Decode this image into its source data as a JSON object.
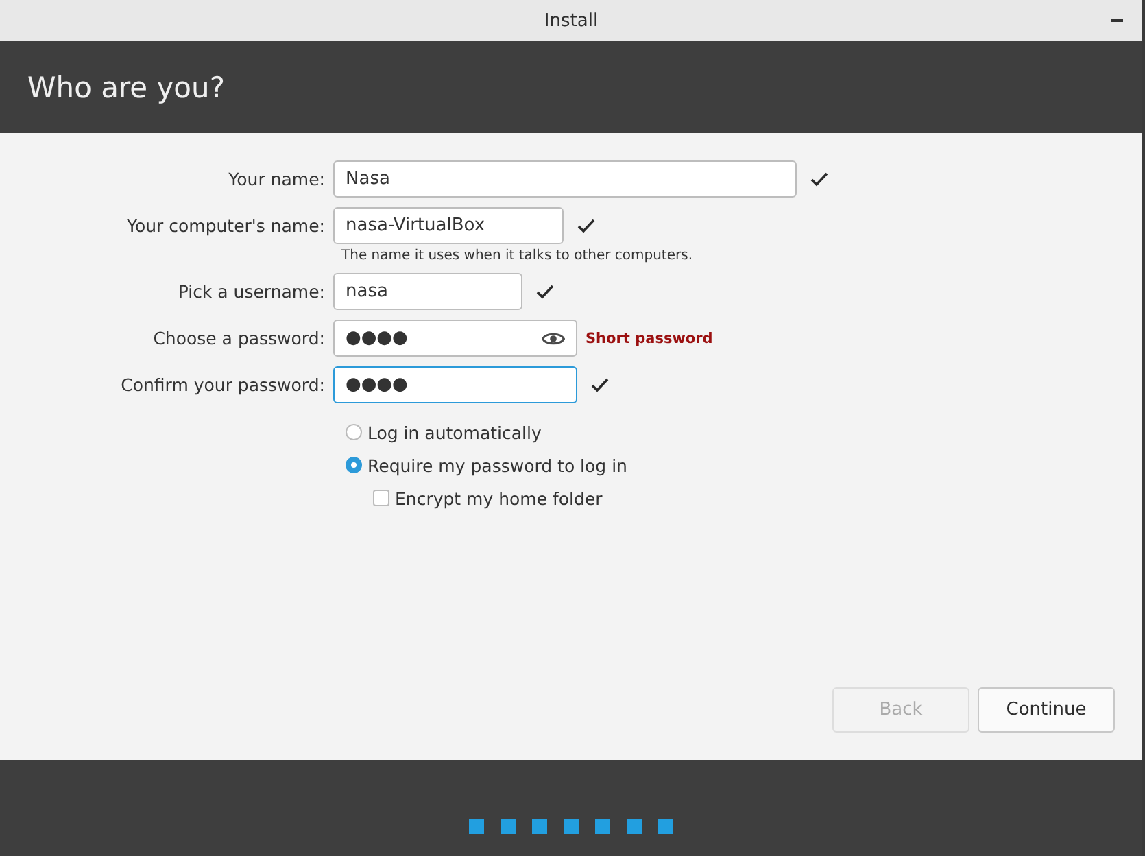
{
  "window": {
    "title": "Install"
  },
  "header": {
    "title": "Who are you?"
  },
  "fields": [
    {
      "label": "Your name:",
      "value": "Nasa",
      "kind": "text",
      "valid": true,
      "focused": false
    },
    {
      "label": "Your computer's name:",
      "value": "nasa-VirtualBox",
      "kind": "text",
      "valid": true,
      "focused": false,
      "hint": "The name it uses when it talks to other computers."
    },
    {
      "label": "Pick a username:",
      "value": "nasa",
      "kind": "text",
      "valid": true,
      "focused": false
    },
    {
      "label": "Choose a password:",
      "value": "●●●●",
      "kind": "password",
      "valid": false,
      "focused": false,
      "message": "Short password"
    },
    {
      "label": "Confirm your password:",
      "value": "●●●●",
      "kind": "password-confirm",
      "valid": true,
      "focused": true
    }
  ],
  "options": [
    {
      "kind": "radio",
      "label": "Log in automatically",
      "selected": false
    },
    {
      "kind": "radio",
      "label": "Require my password to log in",
      "selected": true,
      "children": [
        {
          "kind": "checkbox",
          "label": "Encrypt my home folder",
          "checked": false
        }
      ]
    }
  ],
  "buttons": [
    {
      "label": "Back",
      "disabled": true
    },
    {
      "label": "Continue",
      "disabled": false
    }
  ]
}
